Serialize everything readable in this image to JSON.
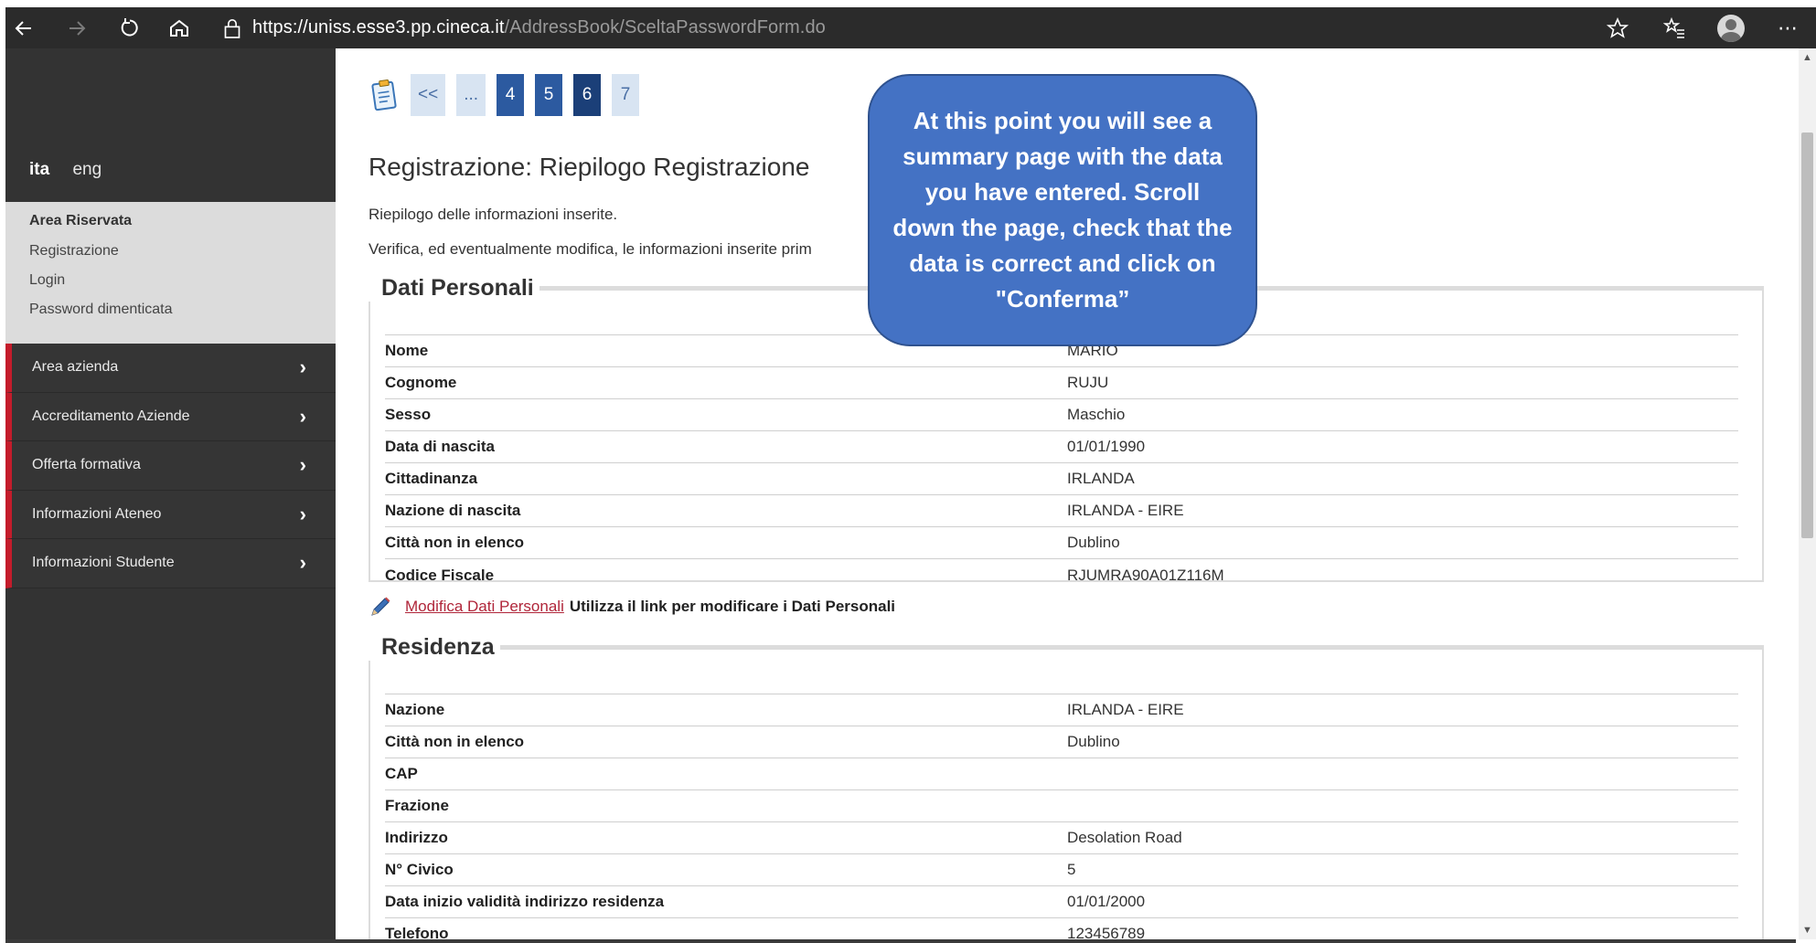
{
  "browser": {
    "url_host": "https://uniss.esse3.pp.cineca.it",
    "url_path": "/AddressBook/SceltaPasswordForm.do"
  },
  "sidebar": {
    "lang_active": "ita",
    "lang_other": "eng",
    "reserved_title": "Area Riservata",
    "reserved_items": [
      "Registrazione",
      "Login",
      "Password dimenticata"
    ],
    "menu": [
      "Area azienda",
      "Accreditamento Aziende",
      "Offerta formativa",
      "Informazioni Ateneo",
      "Informazioni Studente"
    ]
  },
  "pager": {
    "first": "<<",
    "ellipsis": "...",
    "pages": [
      "4",
      "5",
      "6",
      "7"
    ],
    "current": "6"
  },
  "main": {
    "title": "Registrazione: Riepilogo Registrazione",
    "intro1": "Riepilogo delle informazioni inserite.",
    "intro2": "Verifica, ed eventualmente modifica, le informazioni inserite prim"
  },
  "dati_personali": {
    "legend": "Dati Personali",
    "rows": [
      {
        "label": "Nome",
        "value": "MARIO"
      },
      {
        "label": "Cognome",
        "value": "RUJU"
      },
      {
        "label": "Sesso",
        "value": "Maschio"
      },
      {
        "label": "Data di nascita",
        "value": "01/01/1990"
      },
      {
        "label": "Cittadinanza",
        "value": "IRLANDA"
      },
      {
        "label": "Nazione di nascita",
        "value": "IRLANDA - EIRE"
      },
      {
        "label": "Città non in elenco",
        "value": "Dublino"
      },
      {
        "label": "Codice Fiscale",
        "value": "RJUMRA90A01Z116M"
      }
    ]
  },
  "edit": {
    "link": "Modifica Dati Personali ",
    "note": "Utilizza il link per modificare i Dati Personali"
  },
  "residenza": {
    "legend": "Residenza",
    "rows": [
      {
        "label": "Nazione",
        "value": "IRLANDA - EIRE"
      },
      {
        "label": "Città non in elenco",
        "value": "Dublino"
      },
      {
        "label": "CAP",
        "value": ""
      },
      {
        "label": "Frazione",
        "value": ""
      },
      {
        "label": "Indirizzo",
        "value": "Desolation Road"
      },
      {
        "label": "N° Civico",
        "value": "5"
      },
      {
        "label": "Data inizio validità indirizzo residenza",
        "value": "01/01/2000"
      },
      {
        "label": "Telefono",
        "value": "123456789"
      }
    ]
  },
  "callout": "At this point you will see a summary page with the data you have entered. Scroll down the page, check that the data is correct and click on \"Conferma”"
}
